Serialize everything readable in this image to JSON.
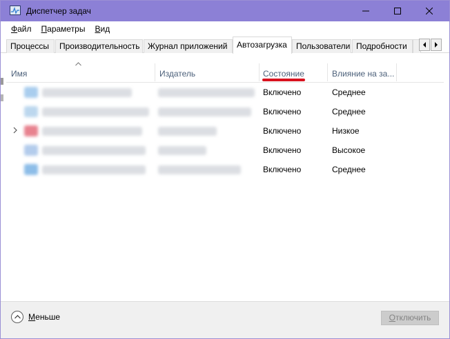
{
  "window": {
    "title": "Диспетчер задач",
    "titlebar_color": "#8c80d6"
  },
  "menu": {
    "items": [
      "Файл",
      "Параметры",
      "Вид"
    ],
    "accelerators": [
      "Ф",
      "П",
      "В"
    ]
  },
  "tabs": {
    "items": [
      "Процессы",
      "Производительность",
      "Журнал приложений",
      "Автозагрузка",
      "Пользователи",
      "Подробности"
    ],
    "active": "Автозагрузка"
  },
  "table": {
    "columns": [
      "Имя",
      "Издатель",
      "Состояние",
      "Влияние на за..."
    ],
    "sorted_column": "Имя",
    "highlighted_column": "Состояние",
    "highlight_color": "#d9121f",
    "rows": [
      {
        "status": "Включено",
        "impact": "Среднее",
        "expandable": false,
        "icon_color": "#a9cdee"
      },
      {
        "status": "Включено",
        "impact": "Среднее",
        "expandable": false,
        "icon_color": "#bcd7ee"
      },
      {
        "status": "Включено",
        "impact": "Низкое",
        "expandable": true,
        "icon_color": "#e8828f"
      },
      {
        "status": "Включено",
        "impact": "Высокое",
        "expandable": false,
        "icon_color": "#b3ccec"
      },
      {
        "status": "Включено",
        "impact": "Среднее",
        "expandable": false,
        "icon_color": "#8dbde8"
      }
    ]
  },
  "footer": {
    "less_label": "Меньше",
    "less_accelerator": "М",
    "disable_label": "Отключить",
    "disable_accelerator": "О"
  }
}
